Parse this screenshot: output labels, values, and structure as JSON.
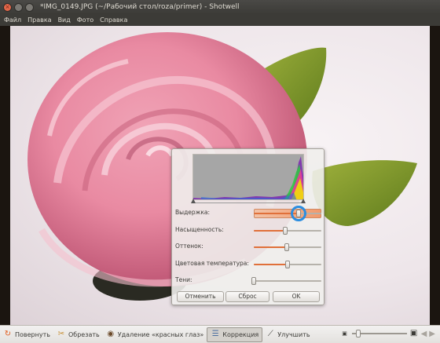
{
  "window": {
    "title": "*IMG_0149.JPG (~/Рабочий стол/roza/primer) - Shotwell",
    "close_glyph": "×"
  },
  "menu": [
    "Файл",
    "Правка",
    "Вид",
    "Фото",
    "Справка"
  ],
  "adjust_dialog": {
    "sliders": [
      {
        "label": "Выдержка:",
        "value": 0.66
      },
      {
        "label": "Насыщенность:",
        "value": 0.47
      },
      {
        "label": "Оттенок:",
        "value": 0.49
      },
      {
        "label": "Цветовая температура:",
        "value": 0.5
      },
      {
        "label": "Тени:",
        "value": 0.0
      }
    ],
    "buttons": {
      "cancel": "Отменить",
      "reset": "Сброс",
      "ok": "OK"
    }
  },
  "toolbar": {
    "rotate": "Повернуть",
    "crop": "Обрезать",
    "redeye": "Удаление «красных глаз»",
    "adjust": "Коррекция",
    "enhance": "Улучшить",
    "zoom_level": 0.08
  },
  "colors": {
    "accent": "#e0703a",
    "focus": "#2b8de0",
    "chrome": "#3c3b37"
  }
}
